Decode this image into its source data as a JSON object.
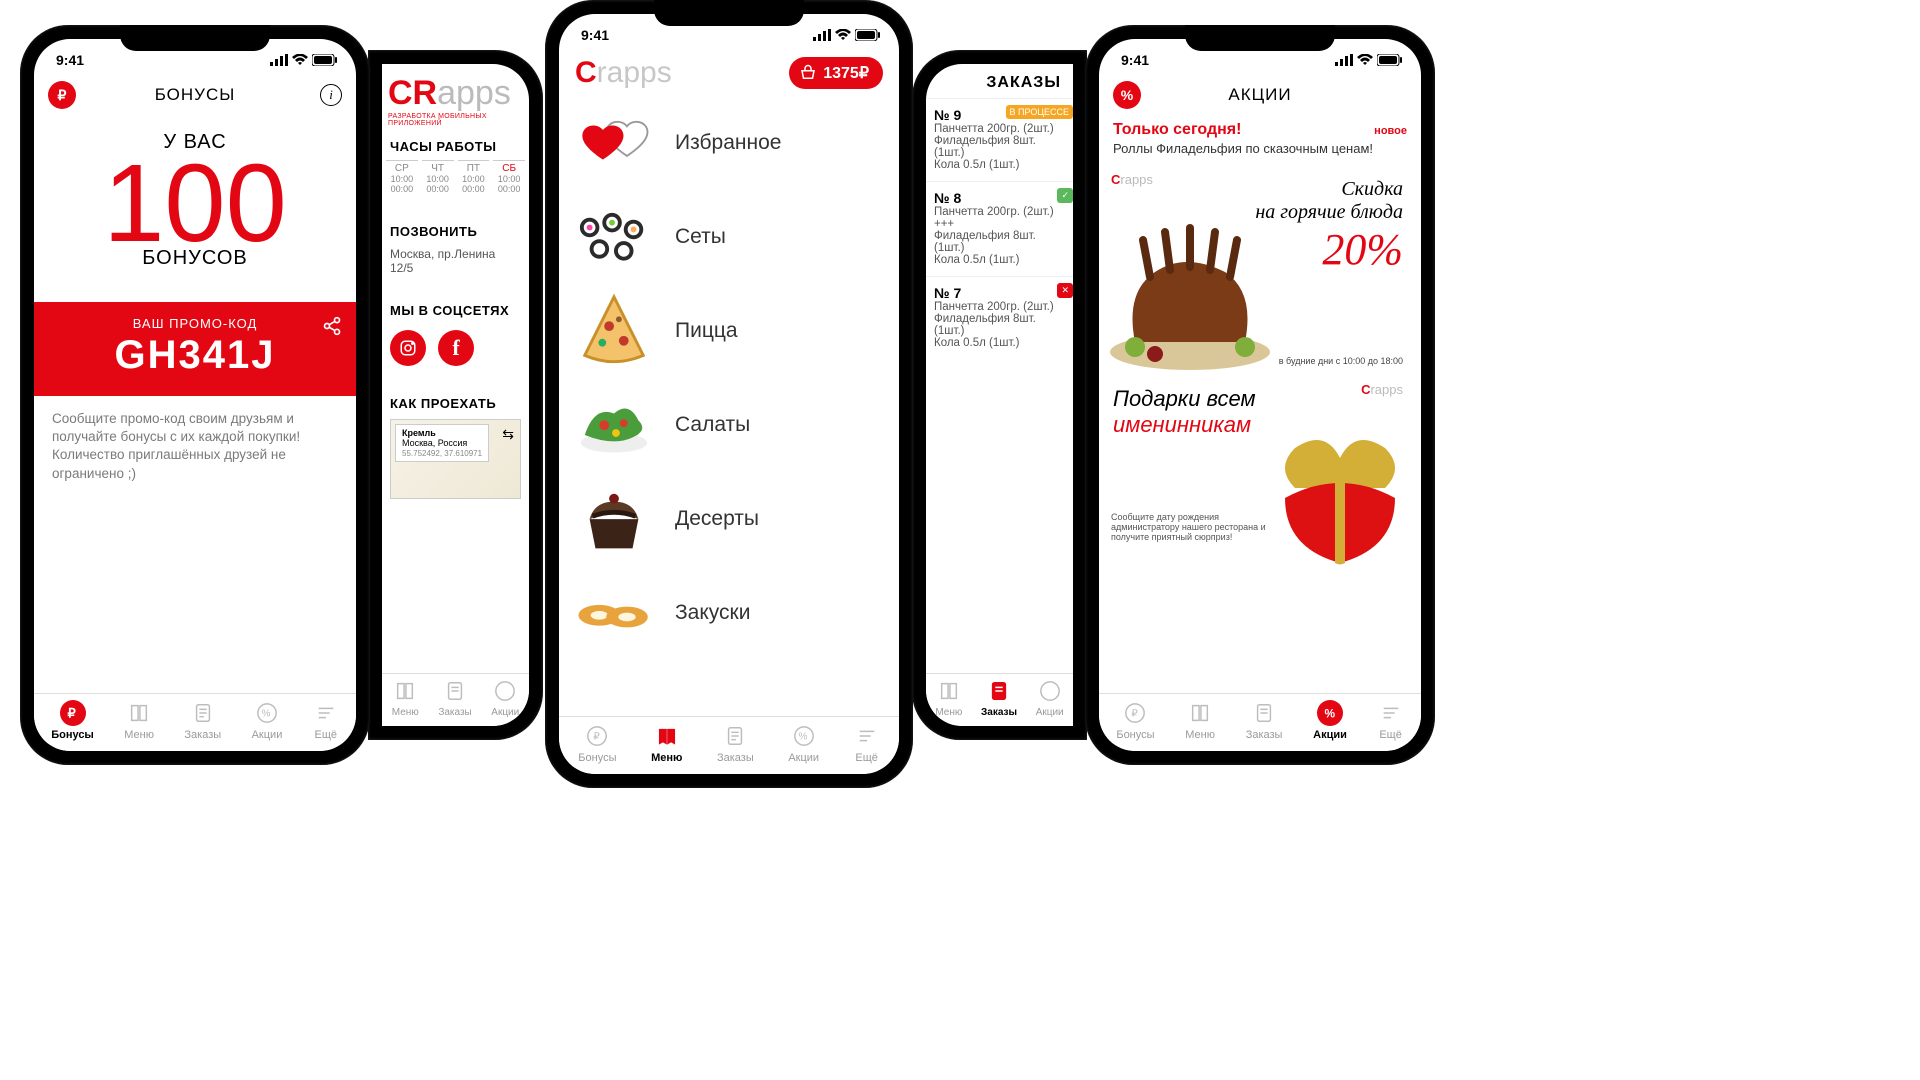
{
  "status_time": "9:41",
  "phone1": {
    "title": "БОНУСЫ",
    "uvas": "У ВАС",
    "count": "100",
    "word": "БОНУСОВ",
    "promo_label": "ВАШ ПРОМО-КОД",
    "promo_code": "GH341J",
    "promo_text": "Сообщите промо-код своим друзьям и получайте бонусы с их каждой покупки! Количество приглашённых друзей не ограничено ;)"
  },
  "phone2": {
    "logo_red": "CR",
    "logo_grey": "apps",
    "logo_sub": "РАЗРАБОТКА МОБИЛЬНЫХ ПРИЛОЖЕНИЙ",
    "section_hours": "ЧАСЫ РАБОТЫ",
    "days": [
      {
        "d": "СР",
        "t1": "10:00",
        "t2": "00:00"
      },
      {
        "d": "ЧТ",
        "t1": "10:00",
        "t2": "00:00"
      },
      {
        "d": "ПТ",
        "t1": "10:00",
        "t2": "00:00"
      },
      {
        "d": "СБ",
        "t1": "10:00",
        "t2": "00:00",
        "on": true
      }
    ],
    "section_call": "ПОЗВОНИТЬ",
    "address": "Москва, пр.Ленина 12/5",
    "section_social": "МЫ В СОЦСЕТЯХ",
    "section_map": "КАК ПРОЕХАТЬ",
    "map_title": "Кремль",
    "map_sub": "Москва, Россия",
    "map_coord": "55.752492, 37.610971"
  },
  "phone3": {
    "brand_c": "C",
    "brand_rest": "rapps",
    "cart_total": "1375₽",
    "items": [
      {
        "label": "Избранное",
        "kind": "fav"
      },
      {
        "label": "Сеты",
        "kind": "sets"
      },
      {
        "label": "Пицца",
        "kind": "pizza"
      },
      {
        "label": "Салаты",
        "kind": "salad"
      },
      {
        "label": "Десерты",
        "kind": "dessert"
      },
      {
        "label": "Закуски",
        "kind": "snack"
      }
    ]
  },
  "phone4": {
    "title": "ЗАКАЗЫ",
    "orders": [
      {
        "num": "№ 9",
        "badge": "В ПРОЦЕССЕ",
        "cls": "",
        "l1": "Панчетта 200гр. (2шт.)",
        "l2": "Филадельфия 8шт. (1шт.)",
        "l3": "Кола 0.5л (1шт.)"
      },
      {
        "num": "№ 8",
        "badge": "✓",
        "cls": "g",
        "l1": "Панчетта 200гр. (2шт.) +++",
        "l2": "Филадельфия 8шт. (1шт.)",
        "l3": "Кола 0.5л (1шт.)"
      },
      {
        "num": "№ 7",
        "badge": "✕",
        "cls": "r",
        "l1": "Панчетта 200гр. (2шт.)",
        "l2": "Филадельфия 8шт. (1шт.)",
        "l3": "Кола 0.5л (1шт.)"
      }
    ]
  },
  "phone5": {
    "title": "АКЦИИ",
    "banner_title": "Только сегодня!",
    "banner_new": "новое",
    "banner_desc": "Роллы Филадельфия по сказочным ценам!",
    "card1": {
      "l1": "Скидка",
      "l2": "на горячие блюда",
      "pct": "20%",
      "small": "в будние дни с 10:00 до 18:00"
    },
    "card2": {
      "l1": "Подарки всем",
      "l2": "именинникам",
      "note": "Сообщите дату рождения администратору нашего ресторана и получите приятный сюрприз!"
    }
  },
  "tabs": {
    "bonus": "Бонусы",
    "menu": "Меню",
    "orders": "Заказы",
    "promo": "Акции",
    "more": "Ещё"
  }
}
